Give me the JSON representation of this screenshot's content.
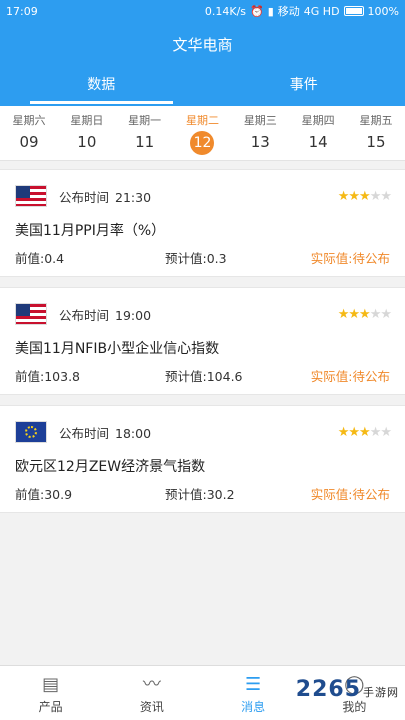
{
  "status_bar": {
    "time": "17:09",
    "speed": "0.14K/s",
    "carrier": "移动",
    "network": "4G HD",
    "battery": "100%"
  },
  "app": {
    "title": "文华电商"
  },
  "tabs": [
    {
      "label": "数据",
      "active": true
    },
    {
      "label": "事件",
      "active": false
    }
  ],
  "week": [
    {
      "name": "星期六",
      "date": "09"
    },
    {
      "name": "星期日",
      "date": "10"
    },
    {
      "name": "星期一",
      "date": "11"
    },
    {
      "name": "星期二",
      "date": "12",
      "active": true
    },
    {
      "name": "星期三",
      "date": "13"
    },
    {
      "name": "星期四",
      "date": "14"
    },
    {
      "name": "星期五",
      "date": "15"
    }
  ],
  "events": [
    {
      "flag": "us-flag",
      "time_label": "公布时间",
      "time": "21:30",
      "importance": 3,
      "title": "美国11月PPI月率（%）",
      "prev": "前值:0.4",
      "forecast": "预计值:0.3",
      "actual": "实际值:待公布"
    },
    {
      "flag": "us-flag",
      "time_label": "公布时间",
      "time": "19:00",
      "importance": 3,
      "title": "美国11月NFIB小型企业信心指数",
      "prev": "前值:103.8",
      "forecast": "预计值:104.6",
      "actual": "实际值:待公布"
    },
    {
      "flag": "eu-flag",
      "time_label": "公布时间",
      "time": "18:00",
      "importance": 3,
      "title": "欧元区12月ZEW经济景气指数",
      "prev": "前值:30.9",
      "forecast": "预计值:30.2",
      "actual": "实际值:待公布"
    }
  ],
  "bottom_nav": [
    {
      "label": "产品",
      "icon": "product-icon"
    },
    {
      "label": "资讯",
      "icon": "news-icon"
    },
    {
      "label": "消息",
      "icon": "message-icon",
      "active": true
    },
    {
      "label": "我的",
      "icon": "profile-icon"
    }
  ],
  "watermark": {
    "brand": "2265",
    "suffix": "手游网"
  },
  "colors": {
    "primary": "#2d9df0",
    "accent": "#f08a2c",
    "star": "#f5b915"
  }
}
